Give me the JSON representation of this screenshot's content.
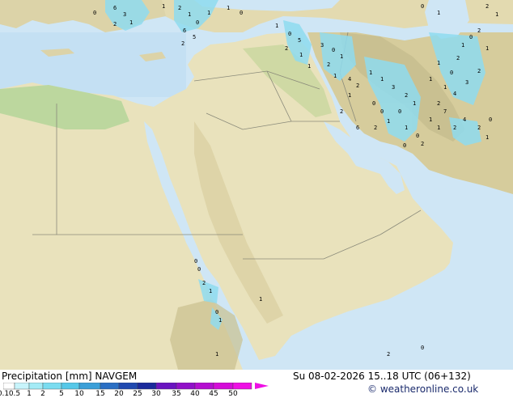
{
  "map": {
    "background_sea": "#cfe6f5",
    "land_color": "#e9e2bc",
    "mountain_color": "#c6bd8e",
    "plain_green": "#bcd79e",
    "precip_color": "#8fdcf0",
    "grid_numbers": [
      {
        "t": "6"
      },
      {
        "t": "3"
      },
      {
        "t": "1"
      },
      {
        "t": "2"
      },
      {
        "t": "0"
      },
      {
        "t": "1"
      },
      {
        "t": "2"
      },
      {
        "t": "1"
      },
      {
        "t": "0"
      },
      {
        "t": "1"
      },
      {
        "t": "6"
      },
      {
        "t": "5"
      },
      {
        "t": "2"
      },
      {
        "t": "1"
      },
      {
        "t": "0"
      },
      {
        "t": "1"
      },
      {
        "t": "0"
      },
      {
        "t": "5"
      },
      {
        "t": "2"
      },
      {
        "t": "1"
      },
      {
        "t": "1"
      },
      {
        "t": "3"
      },
      {
        "t": "0"
      },
      {
        "t": "1"
      },
      {
        "t": "2"
      },
      {
        "t": "1"
      },
      {
        "t": "4"
      },
      {
        "t": "2"
      },
      {
        "t": "1"
      },
      {
        "t": "1"
      },
      {
        "t": "3"
      },
      {
        "t": "2"
      },
      {
        "t": "1"
      },
      {
        "t": "0"
      },
      {
        "t": "1"
      },
      {
        "t": "2"
      },
      {
        "t": "1"
      },
      {
        "t": "0"
      },
      {
        "t": "1"
      },
      {
        "t": "2"
      },
      {
        "t": "1"
      },
      {
        "t": "0"
      },
      {
        "t": "2"
      },
      {
        "t": "1"
      },
      {
        "t": "0"
      },
      {
        "t": "2"
      },
      {
        "t": "1"
      },
      {
        "t": "2"
      },
      {
        "t": "3"
      },
      {
        "t": "4"
      },
      {
        "t": "7"
      },
      {
        "t": "1"
      },
      {
        "t": "2"
      },
      {
        "t": "4"
      },
      {
        "t": "2"
      },
      {
        "t": "1"
      },
      {
        "t": "0"
      },
      {
        "t": "0"
      },
      {
        "t": "6"
      },
      {
        "t": "2"
      },
      {
        "t": "1"
      },
      {
        "t": "0"
      },
      {
        "t": "0"
      },
      {
        "t": "2"
      },
      {
        "t": "1"
      },
      {
        "t": "1"
      },
      {
        "t": "2"
      },
      {
        "t": "1"
      },
      {
        "t": "0"
      },
      {
        "t": "1"
      },
      {
        "t": "2"
      },
      {
        "t": "1"
      },
      {
        "t": "0"
      },
      {
        "t": "1"
      },
      {
        "t": "0"
      },
      {
        "t": "0"
      },
      {
        "t": "1"
      },
      {
        "t": "2"
      },
      {
        "t": "0"
      },
      {
        "t": "1"
      }
    ]
  },
  "footer": {
    "legend_title": "Precipitation [mm]  NAVGEM",
    "valid_time": "Su 08-02-2026 15..18 UTC (06+132)",
    "copyright": "© weatheronline.co.uk",
    "scale": [
      {
        "label": "0.1",
        "color": "#ffffff"
      },
      {
        "label": "0.5",
        "color": "#c8f4fb"
      },
      {
        "label": "1",
        "color": "#a4ebf6"
      },
      {
        "label": "2",
        "color": "#7adcf0"
      },
      {
        "label": "5",
        "color": "#56c8e8"
      },
      {
        "label": "10",
        "color": "#3a9fd8"
      },
      {
        "label": "15",
        "color": "#2a6fc4"
      },
      {
        "label": "20",
        "color": "#1f49b0"
      },
      {
        "label": "25",
        "color": "#1a2a9c"
      },
      {
        "label": "30",
        "color": "#6a14c0"
      },
      {
        "label": "35",
        "color": "#9010c8"
      },
      {
        "label": "40",
        "color": "#b40ed0"
      },
      {
        "label": "45",
        "color": "#d40cd8"
      },
      {
        "label": "50",
        "color": "#ee10e4"
      }
    ]
  }
}
